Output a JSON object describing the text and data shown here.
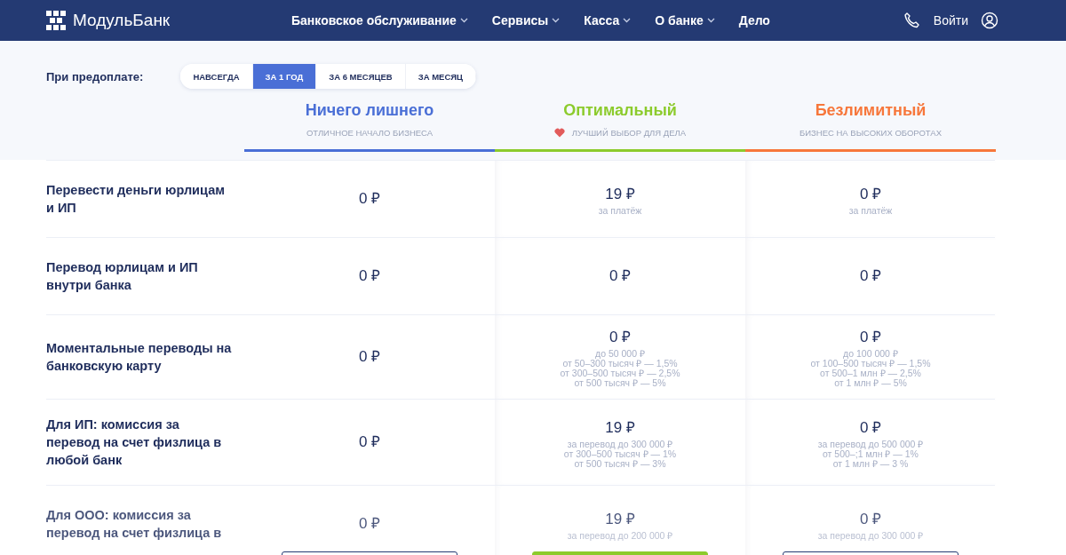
{
  "nav": {
    "logo": "МодульБанк",
    "menu": [
      {
        "label": "Банковское обслуживание",
        "dropdown": true
      },
      {
        "label": "Сервисы",
        "dropdown": true
      },
      {
        "label": "Касса",
        "dropdown": true
      },
      {
        "label": "О банке",
        "dropdown": true
      },
      {
        "label": "Дело",
        "dropdown": false
      }
    ],
    "login": "Войти"
  },
  "prepay": {
    "label": "При предоплате:",
    "tabs": [
      {
        "label": "НАВСЕГДА",
        "selected": false
      },
      {
        "label": "ЗА 1 ГОД",
        "selected": true
      },
      {
        "label": "ЗА 6 МЕСЯЦЕВ",
        "selected": false
      },
      {
        "label": "ЗА МЕСЯЦ",
        "selected": false
      }
    ]
  },
  "plans": [
    {
      "name": "Ничего лишнего",
      "subtitle": "ОТЛИЧНОЕ НАЧАЛО БИЗНЕСА",
      "color": "#4a6fd6",
      "favorite": false
    },
    {
      "name": "Оптимальный",
      "subtitle": "ЛУЧШИЙ ВЫБОР ДЛЯ ДЕЛА",
      "color": "#8ccb2c",
      "favorite": true
    },
    {
      "name": "Безлимитный",
      "subtitle": "БИЗНЕС НА ВЫСОКИХ ОБОРОТАХ",
      "color": "#f7773b",
      "favorite": false
    }
  ],
  "rows": [
    {
      "label": "Перевести деньги юрлицам и ИП",
      "cells": [
        {
          "price": "0 ₽"
        },
        {
          "price": "19 ₽",
          "notes": [
            "за платёж"
          ]
        },
        {
          "price": "0 ₽",
          "notes": [
            "за платёж"
          ]
        }
      ]
    },
    {
      "label": "Перевод юрлицам и ИП внутри банка",
      "cells": [
        {
          "price": "0 ₽"
        },
        {
          "price": "0 ₽"
        },
        {
          "price": "0 ₽"
        }
      ]
    },
    {
      "label": "Моментальные переводы на банковскую карту",
      "cells": [
        {
          "price": "0 ₽"
        },
        {
          "price": "0 ₽",
          "notes": [
            "до 50 000 ₽",
            "от 50–300 тысяч ₽ — 1,5%",
            "от 300–500 тысяч ₽ — 2,5%",
            "от 500 тысяч ₽ — 5%"
          ]
        },
        {
          "price": "0 ₽",
          "notes": [
            "до 100 000 ₽",
            "от 100–500 тысяч ₽ — 1,5%",
            "от 500–1 млн ₽ — 2,5%",
            "от 1 млн ₽ — 5%"
          ]
        }
      ]
    },
    {
      "label": "Для ИП: комиссия за перевод на счет физлица в любой банк",
      "cells": [
        {
          "price": "0 ₽"
        },
        {
          "price": "19 ₽",
          "notes": [
            "за перевод до 300 000 ₽",
            "от 300–500 тысяч ₽ — 1%",
            "от 500 тысяч ₽ — 3%"
          ]
        },
        {
          "price": "0 ₽",
          "notes": [
            "за перевод до 500 000 ₽",
            "от 500–;1 млн ₽ — 1%",
            "от 1 млн ₽ — 3 %"
          ]
        }
      ]
    },
    {
      "label": "Для ООО: комиссия за перевод на счет физлица в",
      "cells": [
        {
          "price": "0 ₽"
        },
        {
          "price": "19 ₽",
          "notes": [
            "за перевод до 200 000 ₽"
          ]
        },
        {
          "price": "0 ₽",
          "notes": [
            "за перевод до 300 000 ₽"
          ]
        }
      ]
    }
  ]
}
